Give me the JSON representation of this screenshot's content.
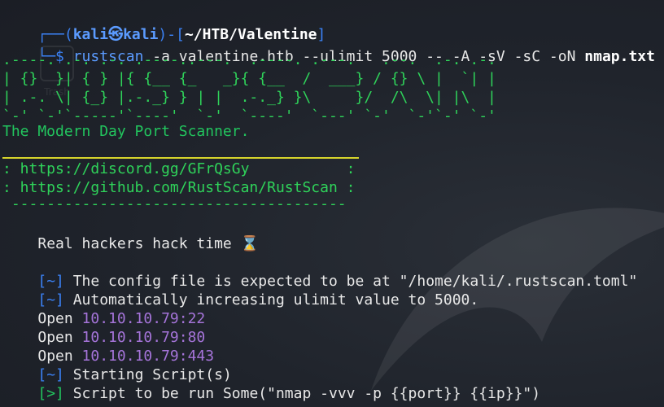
{
  "window": {
    "desktop_label": "Trash"
  },
  "prompt": {
    "corner_top": "┌──(",
    "user": "kali㉿kali",
    "sep": ")-[",
    "path": "~/HTB/Valentine",
    "end": "]",
    "corner_bottom": "└─$ ",
    "command": "rustscan",
    "args": " -a valentine.htb --ulimit 5000 -- -A -sV -sC -oN ",
    "outfile": "nmap.txt"
  },
  "banner": {
    "art": [
      ".----. .-. .-. .----..---.  .----. .---.   .--.  .-. .-.",
      "| {}  }| { } |{ {__ {_   _}{ {__  /  ___} / {} \\ |  `| |",
      "| .-. \\| {_} |.-._} } | |  .-._} }\\     }/  /\\  \\| |\\  |",
      "`-' `-'`-----'`----'  `-'  `----'  `---' `-'  `-'`-' `-'"
    ],
    "tagline": "The Modern Day Port Scanner."
  },
  "links": {
    "discord": ": https://discord.gg/GFrQsGy           :",
    "github": ": https://github.com/RustScan/RustScan :",
    "dashes": " --------------------------------------"
  },
  "motto": {
    "text": "Real hackers hack time ",
    "icon": "⌛"
  },
  "output": {
    "config_tag": "[~]",
    "config_msg": " The config file is expected to be at \"/home/kali/.rustscan.toml\"",
    "ulimit_tag": "[~]",
    "ulimit_msg": " Automatically increasing ulimit value to 5000.",
    "open_label": "Open ",
    "ports": [
      "10.10.10.79:22",
      "10.10.10.79:80",
      "10.10.10.79:443"
    ],
    "script_tag": "[~]",
    "script_msg": " Starting Script(s)",
    "run_tag": "[>]",
    "run_msg": " Script to be run Some(\"nmap -vvv -p {{port}} {{ip}}\")"
  }
}
